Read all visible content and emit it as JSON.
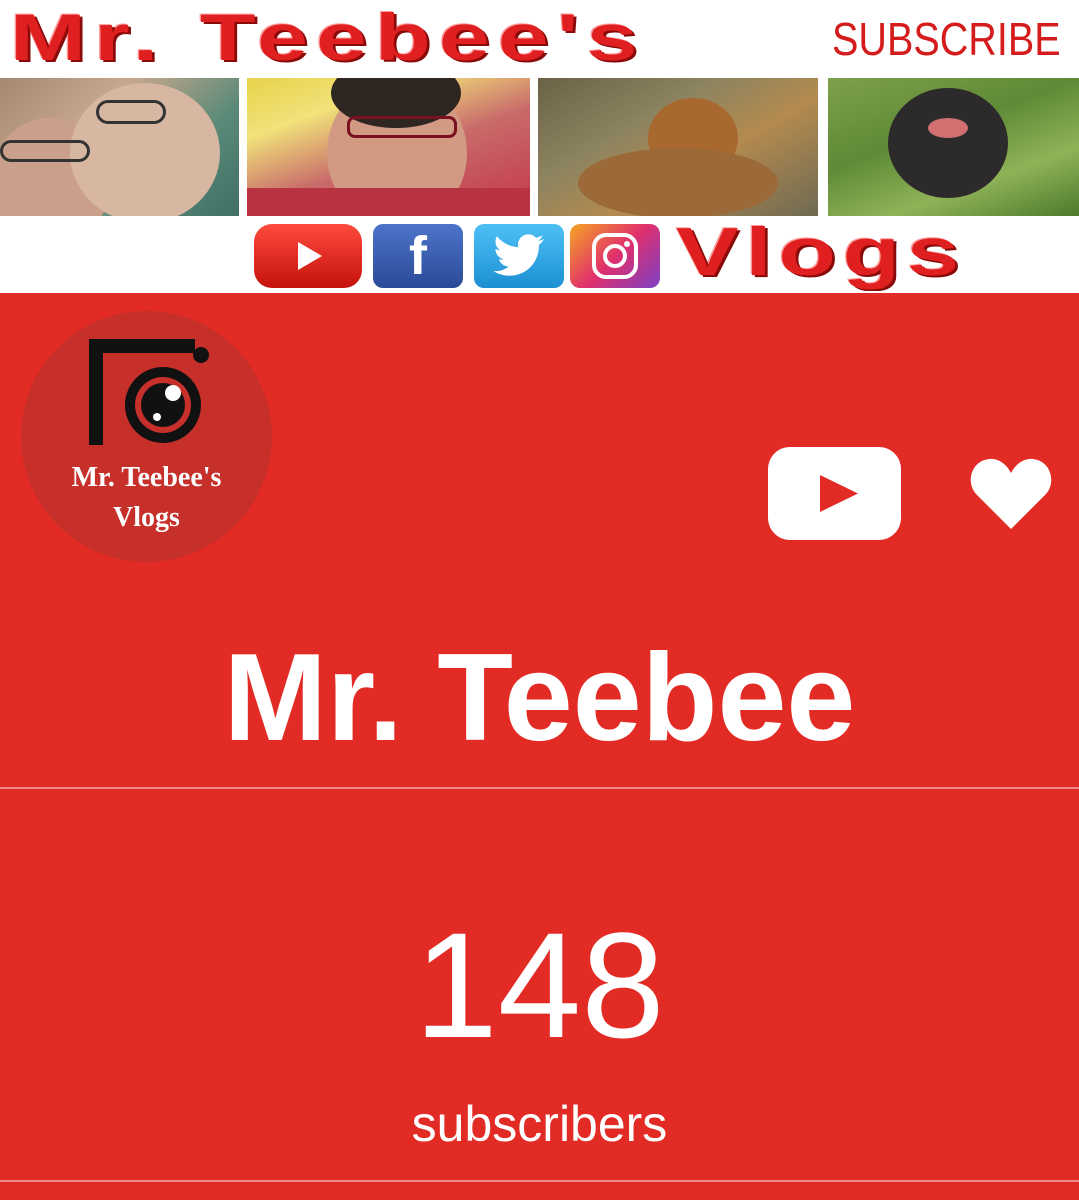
{
  "banner": {
    "title": "Mr. Teebee's",
    "subscribe": "SUBSCRIBE",
    "vlogs": "Vlogs",
    "photos": [
      "couple-selfie",
      "woman-selfie",
      "beagle-dog",
      "black-dog"
    ],
    "social_icons": [
      "youtube-icon",
      "facebook-icon",
      "twitter-icon",
      "instagram-icon"
    ],
    "facebook_glyph": "f"
  },
  "avatar": {
    "line1": "Mr. Teebee's",
    "line2": "Vlogs"
  },
  "channel": {
    "name": "Mr. Teebee",
    "subscriber_count": "148",
    "subscriber_label": "subscribers"
  },
  "colors": {
    "background": "#e32b25",
    "banner_red": "#e02020",
    "text": "#ffffff"
  }
}
